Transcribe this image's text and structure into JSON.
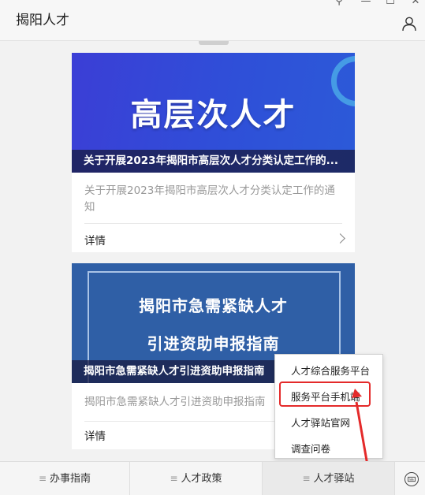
{
  "app": {
    "title": "揭阳人才",
    "window_controls": [
      "⚲",
      "—",
      "☐",
      "✕"
    ],
    "user_icon": "person-icon"
  },
  "cards": [
    {
      "banner_text": "高层次人才",
      "caption": "关于开展2023年揭阳市高层次人才分类认定工作的...",
      "summary": "关于开展2023年揭阳市高层次人才分类认定工作的通知",
      "detail_label": "详情"
    },
    {
      "banner_line1": "揭阳市急需紧缺人才",
      "banner_line2": "引进资助申报指南",
      "caption": "揭阳市急需紧缺人才引进资助申报指南",
      "summary": "揭阳市急需紧缺人才引进资助申报指南",
      "detail_label": "详情"
    }
  ],
  "popup_menu": {
    "items": [
      "人才综合服务平台",
      "服务平台手机端",
      "人才驿站官网",
      "调查问卷"
    ],
    "highlighted_index": 1,
    "highlight_color": "#e42a2a"
  },
  "bottom_nav": {
    "tabs": [
      "办事指南",
      "人才政策",
      "人才驿站"
    ],
    "menu_glyph": "≡",
    "keyboard_icon": "keyboard-icon"
  }
}
